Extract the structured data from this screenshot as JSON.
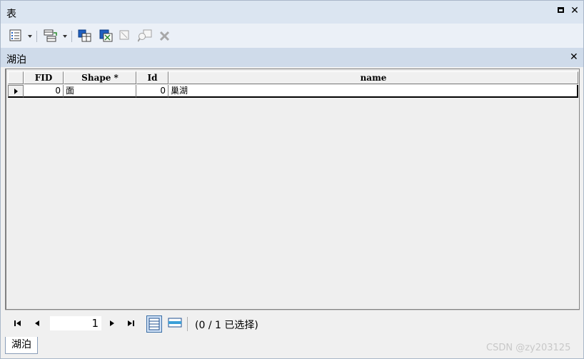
{
  "window": {
    "title": "表"
  },
  "toolbar": {
    "icons": [
      "table-options-icon",
      "related-tables-icon",
      "select-by-attributes-icon",
      "switch-selection-icon",
      "clear-selection-icon",
      "zoom-to-selected-icon",
      "delete-selected-icon"
    ]
  },
  "table": {
    "tab_title": "湖泊",
    "columns": [
      "FID",
      "Shape *",
      "Id",
      "name"
    ],
    "rows": [
      {
        "FID": "0",
        "Shape": "面",
        "Id": "0",
        "name": "巢湖"
      }
    ]
  },
  "navigation": {
    "current_record": "1",
    "selection_text": "(0 / 1 已选择)"
  },
  "bottom_tab": {
    "label": "湖泊"
  },
  "watermark": {
    "text": "CSDN @zy203125"
  },
  "colors": {
    "titlebar": "#dbe5f1",
    "tab_header": "#cfdbea",
    "selected_view": "#cfe0f5"
  }
}
